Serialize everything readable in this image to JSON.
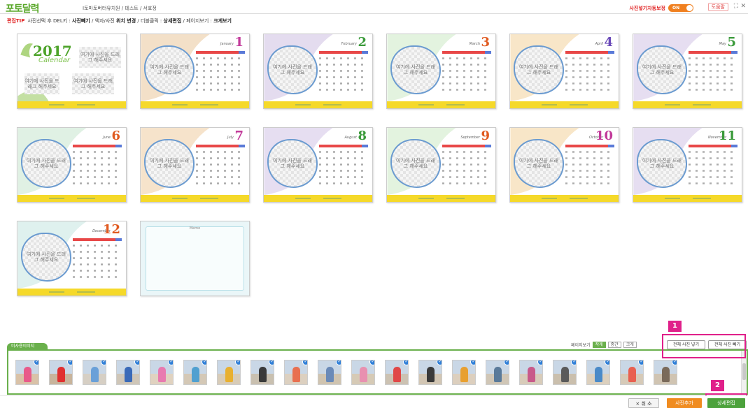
{
  "header": {
    "app_title": "포토달력",
    "breadcrumb": "I토마토버터유치원 / 테스트 / 서효정",
    "autosave_label": "사진넣기자동보정",
    "autosave_state": "ON",
    "help_label": "도움말",
    "restore_icon": "⛶",
    "close_icon": "✕"
  },
  "tip": {
    "label": "편집TIP",
    "text_1": "사진선택 후 DEL키 : ",
    "bold_1": "사진빼기",
    "text_2": " / 액자/사진 ",
    "bold_2": "위치 변경",
    "text_3": " / 더블클릭 : ",
    "bold_3": "상세편집",
    "text_4": " / 페이지보기 : ",
    "bold_4": "크게보기"
  },
  "photo_placeholder": "여기에 사진을 드래그 해주세요",
  "cover": {
    "year": "2017",
    "calendar_word": "Calendar"
  },
  "memo": {
    "title": "Memo"
  },
  "months": [
    {
      "num": "1",
      "name": "January",
      "color": "#c23a9a",
      "bg": "#f3e0c8"
    },
    {
      "num": "2",
      "name": "February",
      "color": "#3a9a3a",
      "bg": "#e4dcef"
    },
    {
      "num": "3",
      "name": "March",
      "color": "#e05a20",
      "bg": "#e3f3df"
    },
    {
      "num": "4",
      "name": "April",
      "color": "#6a4ab8",
      "bg": "#f8e6c8"
    },
    {
      "num": "5",
      "name": "May",
      "color": "#3a9a3a",
      "bg": "#e6def1"
    },
    {
      "num": "6",
      "name": "June",
      "color": "#e05a20",
      "bg": "#e0f1e4"
    },
    {
      "num": "7",
      "name": "July",
      "color": "#c23a9a",
      "bg": "#f6e3cb"
    },
    {
      "num": "8",
      "name": "August",
      "color": "#3a9a3a",
      "bg": "#e6def1"
    },
    {
      "num": "9",
      "name": "September",
      "color": "#e05a20",
      "bg": "#e3f3df"
    },
    {
      "num": "10",
      "name": "October",
      "color": "#c23a9a",
      "bg": "#f8e6c8"
    },
    {
      "num": "11",
      "name": "November",
      "color": "#3a9a3a",
      "bg": "#e6def1"
    },
    {
      "num": "12",
      "name": "December",
      "color": "#e05a20",
      "bg": "#dff1ee"
    }
  ],
  "strip": {
    "tab_label": "미사용이미지",
    "view_label": "페이지보기",
    "view_options": [
      "작게",
      "중간",
      "크게"
    ],
    "insert_all": "전체 사진 넣기",
    "remove_all": "전체 사진 빼기",
    "thumb_count": 20,
    "thumb_check_icon": "check-icon"
  },
  "badges": {
    "one": "1",
    "two": "2"
  },
  "footer": {
    "cancel": "× 취 소",
    "add_photo": "사진추가",
    "detail_edit": "상세편집"
  },
  "colors": {
    "brand_green": "#5aa82a",
    "accent_magenta": "#e0208a",
    "orange": "#f08c20",
    "calendar_header": "#e84848"
  }
}
